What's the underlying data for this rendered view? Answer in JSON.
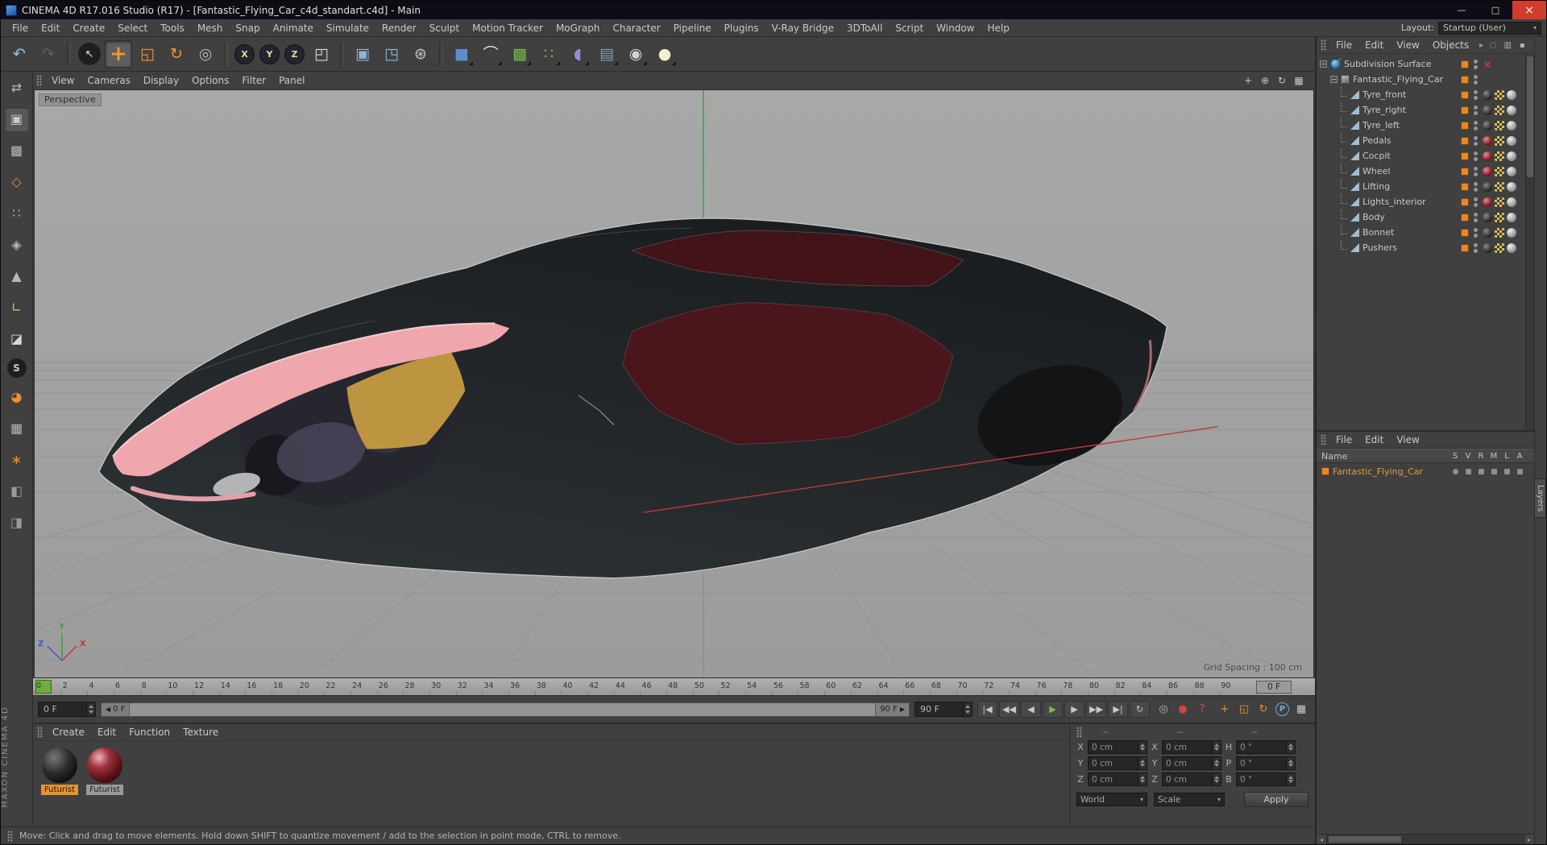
{
  "titlebar": {
    "title": "CINEMA 4D R17.016 Studio (R17) - [Fantastic_Flying_Car_c4d_standart.c4d] - Main",
    "buttons": [
      {
        "name": "minimize",
        "glyph": "—"
      },
      {
        "name": "maximize",
        "glyph": "□"
      },
      {
        "name": "close",
        "glyph": "×"
      }
    ]
  },
  "menubar": {
    "items": [
      "File",
      "Edit",
      "Create",
      "Select",
      "Tools",
      "Mesh",
      "Snap",
      "Animate",
      "Simulate",
      "Render",
      "Sculpt",
      "Motion Tracker",
      "MoGraph",
      "Character",
      "Pipeline",
      "Plugins",
      "V-Ray Bridge",
      "3DToAll",
      "Script",
      "Window",
      "Help"
    ],
    "layout_label": "Layout:",
    "layout_value": "Startup (User)"
  },
  "toolbar": {
    "icons": [
      {
        "name": "undo",
        "glyph": "↶",
        "color": "#9fc0da"
      },
      {
        "name": "redo",
        "glyph": "↷",
        "color": "#5f5f5f"
      },
      {
        "name": "sep"
      },
      {
        "name": "live-selection",
        "glyph": "↖",
        "color": "#e8e8e8",
        "circle": true
      },
      {
        "name": "move-tool",
        "glyph": "+",
        "color": "#f0962e",
        "selected": true
      },
      {
        "name": "scale-tool",
        "glyph": "◱",
        "color": "#f0962e"
      },
      {
        "name": "rotate-tool",
        "glyph": "↻",
        "color": "#f0962e"
      },
      {
        "name": "last-tool",
        "glyph": "◎",
        "color": "#b8b8b8"
      },
      {
        "name": "sep"
      },
      {
        "name": "lock-x-axis",
        "glyph": "X",
        "color": "#e6d78a",
        "pill": true
      },
      {
        "name": "lock-y-axis",
        "glyph": "Y",
        "color": "#e6d78a",
        "pill": true
      },
      {
        "name": "lock-z-axis",
        "glyph": "Z",
        "color": "#e6d78a",
        "pill": true
      },
      {
        "name": "coordinate-system",
        "glyph": "◰",
        "color": "#d8d8d8"
      },
      {
        "name": "sep"
      },
      {
        "name": "render-view",
        "glyph": "▣",
        "color": "#8fb4d8"
      },
      {
        "name": "render-picture-viewer",
        "glyph": "◳",
        "color": "#8fb4d8"
      },
      {
        "name": "render-settings",
        "glyph": "⊛",
        "color": "#c8c8c8"
      },
      {
        "name": "sep"
      },
      {
        "name": "add-cube",
        "glyph": "■",
        "color": "#5d8ec8",
        "dropdown": true
      },
      {
        "name": "pen-spline",
        "glyph": "⌒",
        "color": "#d8e4ec",
        "dropdown": true
      },
      {
        "name": "subdivision-surface",
        "glyph": "▩",
        "color": "#79b648",
        "dropdown": true
      },
      {
        "name": "array-generator",
        "glyph": "∷",
        "color": "#79b648",
        "dropdown": true
      },
      {
        "name": "deformer",
        "glyph": "◖",
        "color": "#8f8fd8",
        "dropdown": true
      },
      {
        "name": "environment",
        "glyph": "▤",
        "color": "#7fa0b0",
        "dropdown": true
      },
      {
        "name": "camera",
        "glyph": "◉",
        "color": "#cfd4d8",
        "dropdown": true
      },
      {
        "name": "light",
        "glyph": "●",
        "color": "#f4eecb",
        "dropdown": true
      }
    ]
  },
  "left_toolbar": {
    "icons": [
      {
        "name": "make-editable",
        "glyph": "⇄",
        "color": "#b8b8b8"
      },
      {
        "name": "model-mode",
        "glyph": "▣",
        "color": "#c8c8c8",
        "selected": true
      },
      {
        "name": "texture-mode",
        "glyph": "▩",
        "color": "#b8b8b8"
      },
      {
        "name": "workplane-mode",
        "glyph": "◇",
        "color": "#d89040"
      },
      {
        "name": "points-mode",
        "glyph": "∷",
        "color": "#b8b8b8"
      },
      {
        "name": "edges-mode",
        "glyph": "◈",
        "color": "#b8b8b8"
      },
      {
        "name": "polygons-mode",
        "glyph": "▲",
        "color": "#b8b8b8"
      },
      {
        "name": "enable-axis",
        "glyph": "∟",
        "color": "#d8b840"
      },
      {
        "name": "paint-tool",
        "glyph": "◪",
        "color": "#d8d8d8"
      },
      {
        "name": "viewport-solo",
        "glyph": "S",
        "color": "#c8c8c8",
        "circle": true
      },
      {
        "name": "enable-snap",
        "glyph": "◕",
        "color": "#e8912e"
      },
      {
        "name": "locked-workplane",
        "glyph": "▦",
        "color": "#b8b8b8"
      },
      {
        "name": "quantize",
        "glyph": "∗",
        "color": "#e8912e"
      },
      {
        "name": "plugin-a",
        "glyph": "◧",
        "color": "#9a9a9a"
      },
      {
        "name": "plugin-b",
        "glyph": "◨",
        "color": "#9a9a9a"
      }
    ]
  },
  "viewport": {
    "menu": [
      "View",
      "Cameras",
      "Display",
      "Options",
      "Filter",
      "Panel"
    ],
    "corner_icons": [
      {
        "name": "viewport-pan",
        "glyph": "+",
        "color": "#c8c8c8"
      },
      {
        "name": "viewport-zoom",
        "glyph": "⊕",
        "color": "#c8c8c8"
      },
      {
        "name": "viewport-rotate",
        "glyph": "↻",
        "color": "#c8c8c8"
      },
      {
        "name": "viewport-toggle",
        "glyph": "▦",
        "color": "#c8c8c8"
      }
    ],
    "camera_label": "Perspective",
    "grid_spacing": "Grid Spacing : 100 cm",
    "axis_labels": {
      "x": "X",
      "y": "Y",
      "z": "Z"
    }
  },
  "timeline": {
    "ticks": [
      "0",
      "2",
      "4",
      "6",
      "8",
      "10",
      "12",
      "14",
      "16",
      "18",
      "20",
      "22",
      "24",
      "26",
      "28",
      "30",
      "32",
      "34",
      "36",
      "38",
      "40",
      "42",
      "44",
      "46",
      "48",
      "50",
      "52",
      "54",
      "56",
      "58",
      "60",
      "62",
      "64",
      "66",
      "68",
      "70",
      "72",
      "74",
      "76",
      "78",
      "80",
      "82",
      "84",
      "86",
      "88",
      "90"
    ],
    "current_frame_box": "0 F",
    "frame_field": "0 F",
    "range_start": "0 F",
    "range_end": "90 F",
    "end_field": "90 F",
    "transport_buttons": [
      {
        "name": "go-to-start",
        "glyph": "|◀",
        "color": "#c8c8c8"
      },
      {
        "name": "previous-key",
        "glyph": "◀◀",
        "color": "#c8c8c8"
      },
      {
        "name": "previous-frame",
        "glyph": "◀",
        "color": "#c8c8c8"
      },
      {
        "name": "play",
        "glyph": "▶",
        "color": "#7bc043"
      },
      {
        "name": "next-frame",
        "glyph": "▶",
        "color": "#c8c8c8"
      },
      {
        "name": "next-key",
        "glyph": "▶▶",
        "color": "#c8c8c8"
      },
      {
        "name": "go-to-end",
        "glyph": "▶|",
        "color": "#c8c8c8"
      },
      {
        "name": "cycle",
        "glyph": "↻",
        "color": "#c8c8c8"
      }
    ],
    "keying_buttons": [
      {
        "name": "autokeying",
        "glyph": "◎",
        "color": "#b8b8b8"
      },
      {
        "name": "record-keyframe",
        "glyph": "●",
        "color": "#d04545"
      },
      {
        "name": "keyframe-help",
        "glyph": "?",
        "color": "#d04545"
      }
    ],
    "keyframe_toggles": [
      {
        "name": "key-position",
        "glyph": "+",
        "color": "#e8912e"
      },
      {
        "name": "key-scale",
        "glyph": "◱",
        "color": "#e8912e"
      },
      {
        "name": "key-rotation",
        "glyph": "↻",
        "color": "#e8912e"
      },
      {
        "name": "key-parameter",
        "glyph": "P",
        "color": "#74a8d8",
        "circle": true
      },
      {
        "name": "key-selection",
        "glyph": "▦",
        "color": "#c8c8c8"
      }
    ]
  },
  "materials": {
    "menu": [
      "Create",
      "Edit",
      "Function",
      "Texture"
    ],
    "items": [
      {
        "label": "Futurist",
        "kind": "black",
        "selected": true
      },
      {
        "label": "Futurist",
        "kind": "red",
        "selected": false
      }
    ]
  },
  "coordinates": {
    "headers": [
      "--",
      "--",
      "--"
    ],
    "rows": [
      {
        "l1": "X",
        "v1": "0 cm",
        "l2": "X",
        "v2": "0 cm",
        "l3": "H",
        "v3": "0 °"
      },
      {
        "l1": "Y",
        "v1": "0 cm",
        "l2": "Y",
        "v2": "0 cm",
        "l3": "P",
        "v3": "0 °"
      },
      {
        "l1": "Z",
        "v1": "0 cm",
        "l2": "Z",
        "v2": "0 cm",
        "l3": "B",
        "v3": "0 °"
      }
    ],
    "dropdown1": "World",
    "dropdown2": "Scale",
    "apply": "Apply"
  },
  "object_manager": {
    "menu": [
      "File",
      "Edit",
      "View",
      "Objects"
    ],
    "corner_icons": [
      {
        "name": "om-search",
        "glyph": "◌",
        "color": "#b0b0b0"
      },
      {
        "name": "om-filter",
        "glyph": "▥",
        "color": "#b0b0b0"
      },
      {
        "name": "om-lock",
        "glyph": "▪",
        "color": "#b0b0b0"
      }
    ],
    "tree": [
      {
        "name": "Subdivision Surface",
        "type": "sds",
        "level": 0,
        "redx": true
      },
      {
        "name": "Fantastic_Flying_Car",
        "type": "null",
        "level": 1
      },
      {
        "name": "Tyre_front",
        "type": "poly",
        "level": 2,
        "material": "dark"
      },
      {
        "name": "Tyre_right",
        "type": "poly",
        "level": 2,
        "material": "dark"
      },
      {
        "name": "Tyre_left",
        "type": "poly",
        "level": 2,
        "material": "dark"
      },
      {
        "name": "Pedals",
        "type": "poly",
        "level": 2,
        "material": "red"
      },
      {
        "name": "Cocpit",
        "type": "poly",
        "level": 2,
        "material": "red"
      },
      {
        "name": "Wheel",
        "type": "poly",
        "level": 2,
        "material": "red"
      },
      {
        "name": "Lifting",
        "type": "poly",
        "level": 2,
        "material": "dark"
      },
      {
        "name": "Lights_interior",
        "type": "poly",
        "level": 2,
        "material": "red"
      },
      {
        "name": "Body",
        "type": "poly",
        "level": 2,
        "material": "dark"
      },
      {
        "name": "Bonnet",
        "type": "poly",
        "level": 2,
        "material": "dark"
      },
      {
        "name": "Pushers",
        "type": "poly",
        "level": 2,
        "material": "dark"
      }
    ]
  },
  "layer_panel": {
    "menu": [
      "File",
      "Edit",
      "View"
    ],
    "name_header": "Name",
    "columns": [
      "S",
      "V",
      "R",
      "M",
      "L",
      "A"
    ],
    "rows": [
      {
        "name": "Fantastic_Flying_Car"
      }
    ]
  },
  "status_bar": {
    "text": "Move: Click and drag to move elements. Hold down SHIFT to quantize movement / add to the selection in point mode, CTRL to remove."
  },
  "branding": {
    "vertical": "MAXON CINEMA 4D"
  },
  "layers_tab": {
    "label": "Layers"
  },
  "scene": {
    "colors": {
      "car_body": "#24282b",
      "car_outline": "#c3c7c9",
      "canopy": "#421318",
      "canopy_side": "#4a151b",
      "stripe": "#efa6ad",
      "stripe_edge": "#f9d8da",
      "accent_gold": "#bd9440",
      "cockpit": "#26262e",
      "cockpit_purple": "#4a4458",
      "wheel_dark": "#121416",
      "grid_line": "#919191",
      "axis_x": "#c03838",
      "axis_y": "#3f9e3f",
      "axis_z": "#3a5fd0",
      "accent_orange": "#e8912e",
      "playhead_green": "#6fae3e"
    }
  }
}
